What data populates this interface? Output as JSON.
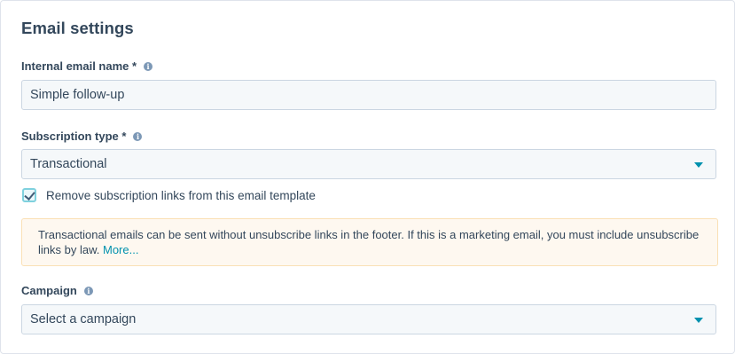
{
  "section": {
    "title": "Email settings"
  },
  "internal_name": {
    "label": "Internal email name *",
    "value": "Simple follow-up"
  },
  "subscription_type": {
    "label": "Subscription type *",
    "selected": "Transactional"
  },
  "remove_links": {
    "label": "Remove subscription links from this email template",
    "checked": true
  },
  "notice": {
    "text": "Transactional emails can be sent without unsubscribe links in the footer. If this is a marketing email, you must include unsubscribe links by law.",
    "link": "More..."
  },
  "campaign": {
    "label": "Campaign",
    "placeholder": "Select a campaign"
  },
  "icons": {
    "info": "i"
  },
  "colors": {
    "accent": "#0091ae",
    "text": "#33475b",
    "notice_bg": "#fef8f0",
    "notice_border": "#fae0b5"
  }
}
